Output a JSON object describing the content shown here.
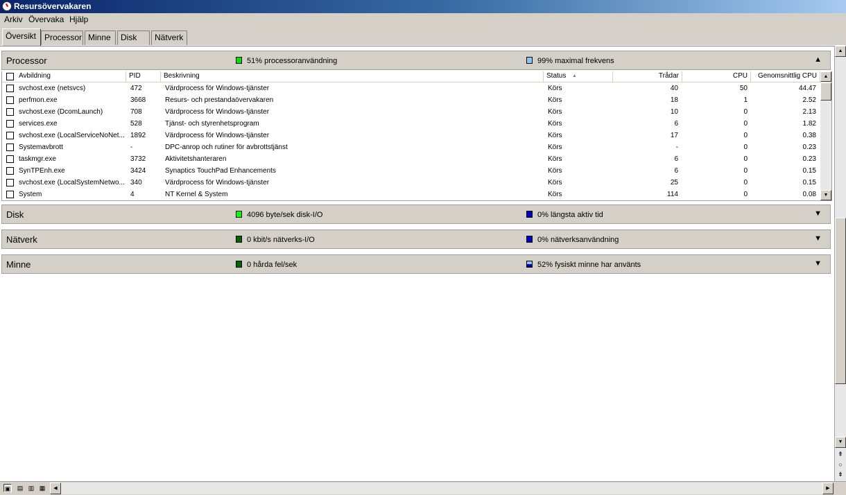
{
  "window": {
    "title": "Resursövervakaren"
  },
  "menu": {
    "items": [
      "Arkiv",
      "Övervaka",
      "Hjälp"
    ]
  },
  "tabs": [
    "Översikt",
    "Processor",
    "Minne",
    "Disk",
    "Nätverk"
  ],
  "processor": {
    "title": "Processor",
    "ind1": "51% processoranvändning",
    "ind2": "99% maximal frekvens",
    "columns": {
      "image": "Avbildning",
      "pid": "PID",
      "desc": "Beskrivning",
      "status": "Status",
      "threads": "Trådar",
      "cpu": "CPU",
      "avgcpu": "Genomsnittlig CPU"
    },
    "rows": [
      {
        "image": "svchost.exe (netsvcs)",
        "pid": "472",
        "desc": "Värdprocess för Windows-tjänster",
        "status": "Körs",
        "threads": "40",
        "cpu": "50",
        "avgcpu": "44.47"
      },
      {
        "image": "perfmon.exe",
        "pid": "3668",
        "desc": "Resurs- och prestandaövervakaren",
        "status": "Körs",
        "threads": "18",
        "cpu": "1",
        "avgcpu": "2.52"
      },
      {
        "image": "svchost.exe (DcomLaunch)",
        "pid": "708",
        "desc": "Värdprocess för Windows-tjänster",
        "status": "Körs",
        "threads": "10",
        "cpu": "0",
        "avgcpu": "2.13"
      },
      {
        "image": "services.exe",
        "pid": "528",
        "desc": "Tjänst- och styrenhetsprogram",
        "status": "Körs",
        "threads": "6",
        "cpu": "0",
        "avgcpu": "1.82"
      },
      {
        "image": "svchost.exe (LocalServiceNoNet...",
        "pid": "1892",
        "desc": "Värdprocess för Windows-tjänster",
        "status": "Körs",
        "threads": "17",
        "cpu": "0",
        "avgcpu": "0.38"
      },
      {
        "image": "Systemavbrott",
        "pid": "-",
        "desc": "DPC-anrop och rutiner för avbrottstjänst",
        "status": "Körs",
        "threads": "-",
        "cpu": "0",
        "avgcpu": "0.23"
      },
      {
        "image": "taskmgr.exe",
        "pid": "3732",
        "desc": "Aktivitetshanteraren",
        "status": "Körs",
        "threads": "6",
        "cpu": "0",
        "avgcpu": "0.23"
      },
      {
        "image": "SynTPEnh.exe",
        "pid": "3424",
        "desc": "Synaptics TouchPad Enhancements",
        "status": "Körs",
        "threads": "6",
        "cpu": "0",
        "avgcpu": "0.15"
      },
      {
        "image": "svchost.exe (LocalSystemNetwo...",
        "pid": "340",
        "desc": "Värdprocess för Windows-tjänster",
        "status": "Körs",
        "threads": "25",
        "cpu": "0",
        "avgcpu": "0.15"
      },
      {
        "image": "System",
        "pid": "4",
        "desc": "NT Kernel & System",
        "status": "Körs",
        "threads": "114",
        "cpu": "0",
        "avgcpu": "0.08"
      }
    ]
  },
  "disk": {
    "title": "Disk",
    "ind1": "4096 byte/sek disk-I/O",
    "ind2": "0% längsta aktiv tid"
  },
  "network": {
    "title": "Nätverk",
    "ind1": "0 kbit/s nätverks-I/O",
    "ind2": "0% nätverksanvändning"
  },
  "memory": {
    "title": "Minne",
    "ind1": "0 hårda fel/sek",
    "ind2": "52% fysiskt minne har använts"
  },
  "colors": {
    "green_bright": "#00ff00",
    "green_dark": "#006400",
    "blue_light": "#87c8f0",
    "blue_dark": "#0000c0"
  }
}
